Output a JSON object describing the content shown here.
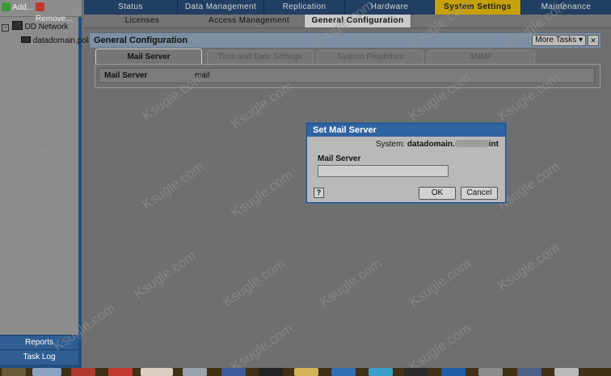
{
  "left_toolbar": {
    "add_label": "Add...",
    "remove_label": "Remove..."
  },
  "tree": {
    "root_label": "DD Network",
    "child_label": "datadomain.pola"
  },
  "left_bottom": {
    "reports_label": "Reports",
    "task_log_label": "Task Log"
  },
  "top_nav": [
    "Status",
    "Data Management",
    "Replication",
    "Hardware",
    "System Settings",
    "Maintenance"
  ],
  "top_nav_active": "System Settings",
  "sub_nav": [
    "Licenses",
    "Access Management",
    "General Configuration"
  ],
  "sub_nav_active": "General Configuration",
  "panel": {
    "title": "General Configuration",
    "more_tasks_label": "More Tasks ▾",
    "close_glyph": "✕"
  },
  "tabs": [
    "Mail Server",
    "Time and Date Settings",
    "System Properties",
    "SNMP"
  ],
  "tabs_active": "Mail Server",
  "field": {
    "label": "Mail Server",
    "value": "mail"
  },
  "dialog": {
    "title": "Set Mail Server",
    "system_prefix": "System:",
    "system_host_start": "datadomain.",
    "system_host_end": "int",
    "field_label": "Mail Server",
    "input_value": "",
    "help_label": "?",
    "ok_label": "OK",
    "cancel_label": "Cancel"
  },
  "watermark_text": "Ksugle.com",
  "colors": {
    "nav_bg": "#203f63",
    "nav_active": "#c6a10c",
    "dialog_title": "#2f63a2",
    "left_accent": "#1f4f7e"
  }
}
